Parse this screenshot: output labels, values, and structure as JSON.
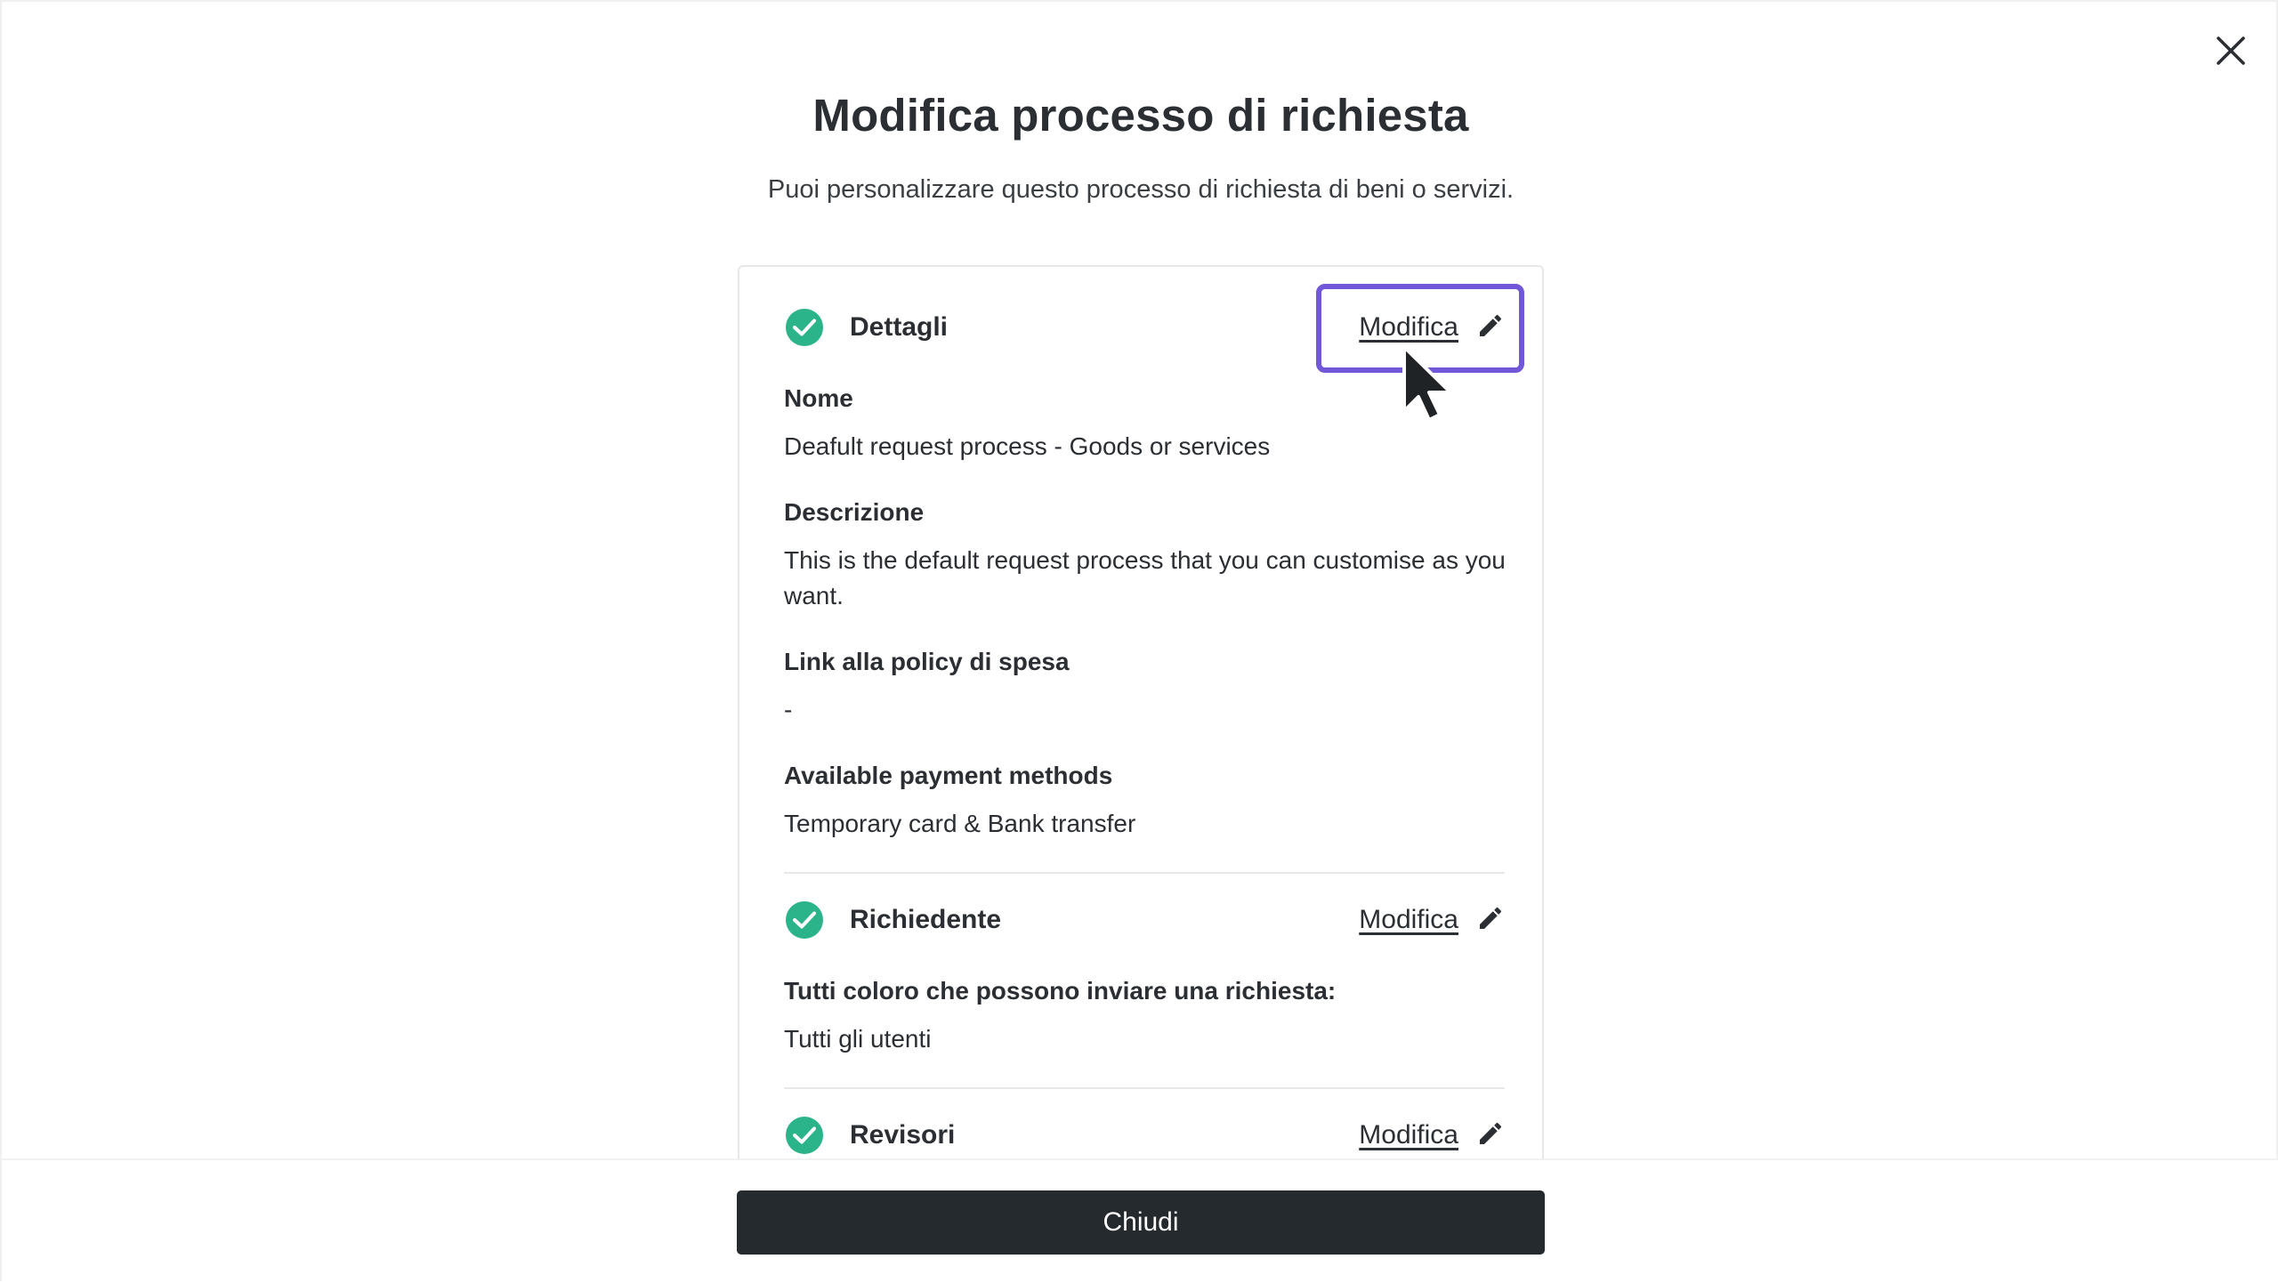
{
  "modal": {
    "title": "Modifica processo di richiesta",
    "subtitle": "Puoi personalizzare questo processo di richiesta di beni o servizi."
  },
  "sections": {
    "details": {
      "title": "Dettagli",
      "edit_label": "Modifica",
      "name_label": "Nome",
      "name_value": "Deafult request process - Goods or services",
      "description_label": "Descrizione",
      "description_value": "This is the default request process that you can customise as you want.",
      "policy_label": "Link alla policy di spesa",
      "policy_value": "-",
      "payment_label": "Available payment methods",
      "payment_value": "Temporary card & Bank transfer"
    },
    "requester": {
      "title": "Richiedente",
      "edit_label": "Modifica",
      "who_label": "Tutti coloro che possono inviare una richiesta:",
      "who_value": "Tutti gli utenti"
    },
    "reviewers": {
      "title": "Revisori",
      "edit_label": "Modifica"
    }
  },
  "footer": {
    "close_label": "Chiudi"
  },
  "icons": {
    "close": "close-icon",
    "check": "check-circle-icon",
    "edit": "pencil-icon",
    "cursor": "mouse-pointer-icon"
  },
  "colors": {
    "check_green": "#2bb38a",
    "focus_ring": "#7257d9",
    "primary_button": "#252a2e",
    "text": "#2b2f33"
  }
}
